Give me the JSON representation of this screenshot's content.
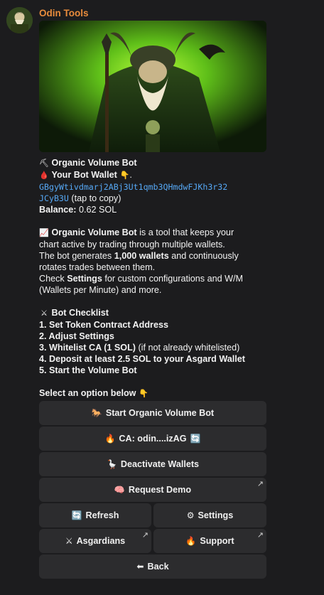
{
  "sender": "Odin Tools",
  "message": {
    "title": "Organic Volume Bot",
    "wallet_label": "Your Bot Wallet",
    "wallet_suffix": ".",
    "wallet_address_line1": "GBgyWtivdmarj2ABj3Ut1qmb3QHmdwFJKh3r32",
    "wallet_address_line2": "JCyB3U",
    "tap_to_copy": "(tap to copy)",
    "balance_label": "Balance:",
    "balance_value": "0.62 SOL",
    "desc_bold": "Organic Volume Bot",
    "desc_1a": " is a tool that keeps your",
    "desc_2": "chart active by trading through multiple wallets.",
    "desc_3a": "The bot generates ",
    "desc_3b": "1,000 wallets",
    "desc_3c": " and continuously",
    "desc_4": "rotates trades between them.",
    "desc_5a": "Check ",
    "desc_5b": "Settings",
    "desc_5c": " for custom configurations and W/M",
    "desc_6": "(Wallets per Minute) and more.",
    "checklist_title": "Bot Checklist",
    "checklist": [
      "1. Set Token Contract Address",
      "2. Adjust Settings",
      "3. Whitelist CA (1 SOL)",
      "4. Deposit at least 2.5 SOL to your Asgard Wallet",
      "5. Start the Volume Bot"
    ],
    "checklist_3_note": " (if not already whitelisted)",
    "select_prompt": "Select an option below"
  },
  "buttons": {
    "start": "Start Organic Volume Bot",
    "ca": "CA: odin....izAG",
    "deactivate": "Deactivate Wallets",
    "demo": "Request Demo",
    "refresh": "Refresh",
    "settings": "Settings",
    "asgardians": "Asgardians",
    "support": "Support",
    "back": "Back"
  },
  "icons": {
    "pick": "⛏",
    "drop": "🩸",
    "point_down": "👇",
    "chart": "📈",
    "swords": "⚔",
    "horse": "🐎",
    "fire": "🔥",
    "goose": "🪿",
    "brain": "🧠",
    "refresh": "🔄",
    "gear": "⚙",
    "back": "⬅",
    "external": "↗"
  },
  "colors": {
    "sender": "#e88b3c",
    "link": "#56a8f5",
    "button_bg": "#2c2c2e",
    "background": "#1c1c1e"
  }
}
